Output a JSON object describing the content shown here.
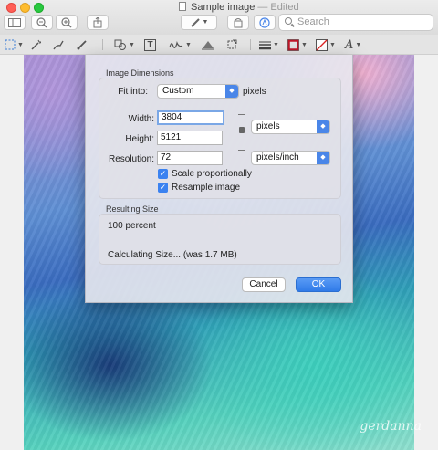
{
  "window": {
    "title": "Sample image",
    "title_status": "— Edited",
    "search_placeholder": "Search"
  },
  "dialog": {
    "dimensions_label": "Image Dimensions",
    "fit_into_label": "Fit into:",
    "fit_into_value": "Custom",
    "fit_into_units": "pixels",
    "width_label": "Width:",
    "width_value": "3804",
    "height_label": "Height:",
    "height_value": "5121",
    "size_units": "pixels",
    "resolution_label": "Resolution:",
    "resolution_value": "72",
    "resolution_units": "pixels/inch",
    "scale_label": "Scale proportionally",
    "scale_checked": true,
    "resample_label": "Resample image",
    "resample_checked": true,
    "resulting_label": "Resulting Size",
    "percent_text": "100 percent",
    "calc_text": "Calculating Size... (was 1.7 MB)",
    "cancel_label": "Cancel",
    "ok_label": "OK"
  },
  "markup_toolbar": {
    "text_tool_glyph": "T",
    "font_tool_glyph": "A"
  },
  "painting": {
    "signature": "gerdanna"
  },
  "colors": {
    "accent": "#3b82f0",
    "border_color_swatch": "#c0182a"
  }
}
